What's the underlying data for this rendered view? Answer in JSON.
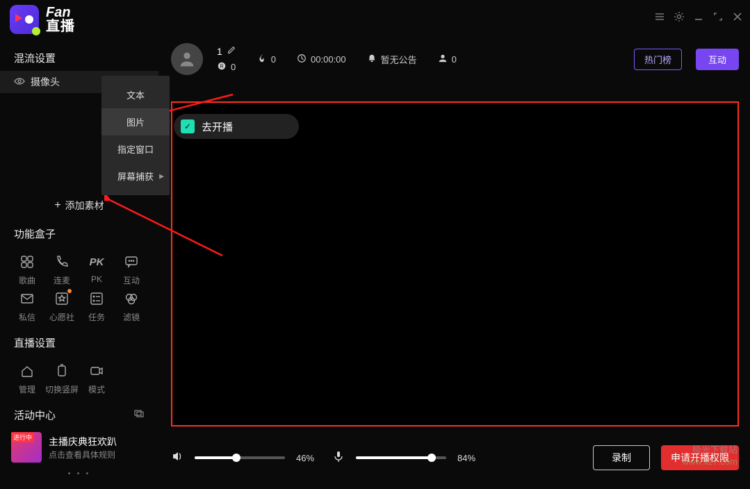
{
  "app": {
    "name_en": "Fan",
    "name_cn": "直播"
  },
  "sidebar": {
    "mix_heading": "混流设置",
    "camera_label": "摄像头",
    "add_material": "添加素材",
    "toolbox_heading": "功能盒子",
    "tools": [
      {
        "label": "歌曲",
        "name": "music"
      },
      {
        "label": "连麦",
        "name": "mic-link"
      },
      {
        "label": "PK",
        "name": "pk"
      },
      {
        "label": "互动",
        "name": "interact"
      },
      {
        "label": "私信",
        "name": "dm"
      },
      {
        "label": "心愿社",
        "name": "wish"
      },
      {
        "label": "任务",
        "name": "tasks"
      },
      {
        "label": "滤镜",
        "name": "filter"
      }
    ],
    "live_heading": "直播设置",
    "live_tools": [
      {
        "label": "管理",
        "name": "manage"
      },
      {
        "label": "切换竖屏",
        "name": "rotate"
      },
      {
        "label": "模式",
        "name": "mode"
      }
    ],
    "activity_heading": "活动中心",
    "activity_badge": "进行中",
    "activity_title": "主播庆典狂欢趴",
    "activity_sub": "点击查看具体规则"
  },
  "context_menu": {
    "items": [
      {
        "label": "文本",
        "name": "text"
      },
      {
        "label": "图片",
        "name": "image",
        "highlight": true
      },
      {
        "label": "指定窗口",
        "name": "window"
      },
      {
        "label": "屏幕捕获",
        "name": "screen",
        "submenu": true
      }
    ]
  },
  "header": {
    "username": "1",
    "coin": "0",
    "fire": "0",
    "time": "00:00:00",
    "announcement": "暂无公告",
    "viewers": "0",
    "hot_btn": "热门榜",
    "interact_btn": "互动"
  },
  "go_live": "去开播",
  "bottom": {
    "speaker_pct": "46%",
    "mic_pct": "84%",
    "record_btn": "录制",
    "apply_btn": "申请开播权限"
  },
  "watermark": {
    "title": "极光下载站",
    "url": "www.xz7.com"
  }
}
